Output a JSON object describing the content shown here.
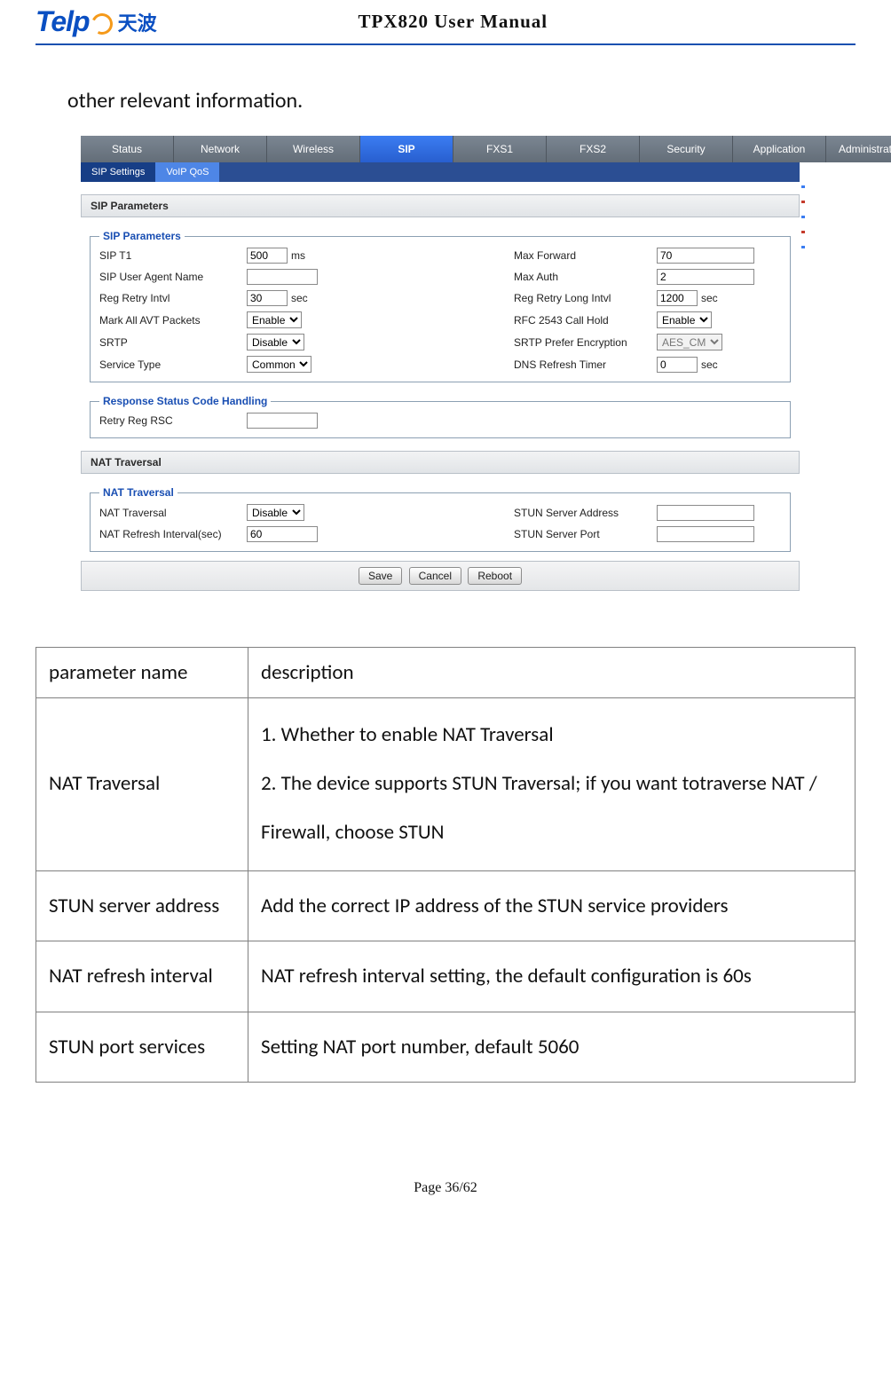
{
  "doc": {
    "brand_en": "Telp",
    "brand_cn": "天波",
    "title": "TPX820 User Manual",
    "intro": "other relevant information.",
    "page_label": "Page 36/62"
  },
  "tabs": {
    "items": [
      "Status",
      "Network",
      "Wireless",
      "SIP",
      "FXS1",
      "FXS2",
      "Security",
      "Application",
      "Administration"
    ],
    "active_index": 3,
    "sub_items": [
      "SIP Settings",
      "VoIP QoS"
    ],
    "sub_active_index": 1
  },
  "sections": {
    "sip_parameters_bar": "SIP Parameters",
    "sip_parameters_legend": "SIP Parameters",
    "rows": [
      {
        "l": "SIP T1",
        "ctrl": "text",
        "val": "500",
        "w": "w46",
        "unit": "ms",
        "r": "Max Forward",
        "rctrl": "text",
        "rval": "70",
        "rw": "w110",
        "runit": ""
      },
      {
        "l": "SIP User Agent Name",
        "ctrl": "text",
        "val": "",
        "w": "w80",
        "unit": "",
        "r": "Max Auth",
        "rctrl": "text",
        "rval": "2",
        "rw": "w110",
        "runit": ""
      },
      {
        "l": "Reg Retry Intvl",
        "ctrl": "text",
        "val": "30",
        "w": "w46",
        "unit": "sec",
        "r": "Reg Retry Long Intvl",
        "rctrl": "text",
        "rval": "1200",
        "rw": "w46",
        "runit": "sec"
      },
      {
        "l": "Mark All AVT Packets",
        "ctrl": "select",
        "val": "Enable",
        "unit": "",
        "r": "RFC 2543 Call Hold",
        "rctrl": "select",
        "rval": "Enable",
        "runit": ""
      },
      {
        "l": "SRTP",
        "ctrl": "select",
        "val": "Disable",
        "unit": "",
        "r": "SRTP Prefer Encryption",
        "rctrl": "select_disabled",
        "rval": "AES_CM",
        "runit": ""
      },
      {
        "l": "Service Type",
        "ctrl": "select",
        "val": "Common",
        "unit": "",
        "r": "DNS Refresh Timer",
        "rctrl": "text",
        "rval": "0",
        "rw": "w46",
        "runit": "sec"
      }
    ],
    "rsc_legend": "Response Status Code Handling",
    "rsc_label": "Retry Reg RSC",
    "rsc_val": "",
    "nat_bar": "NAT Traversal",
    "nat_legend": "NAT Traversal",
    "nat_rows": [
      {
        "l": "NAT Traversal",
        "ctrl": "select",
        "val": "Disable",
        "r": "STUN Server Address",
        "rctrl": "text",
        "rval": "",
        "rw": "w110"
      },
      {
        "l": "NAT Refresh Interval(sec)",
        "ctrl": "text",
        "val": "60",
        "w": "w80",
        "r": "STUN Server Port",
        "rctrl": "text",
        "rval": "",
        "rw": "w110"
      }
    ],
    "buttons": {
      "save": "Save",
      "cancel": "Cancel",
      "reboot": "Reboot"
    }
  },
  "table": {
    "header": {
      "param": "parameter name",
      "desc": "description"
    },
    "rows": [
      {
        "param": "NAT Traversal",
        "desc": "1. Whether to enable NAT Traversal\n2. The device supports STUN Traversal; if you want totraverse NAT / Firewall, choose STUN"
      },
      {
        "param": "STUN server address",
        "desc": "Add   the   correct IP address   of   the STUN service providers"
      },
      {
        "param": "NAT refresh interval",
        "desc": "NAT refresh     interval     setting,     the     default configuration is 60s"
      },
      {
        "param": "STUN port services",
        "desc": "Setting NAT port number, default 5060"
      }
    ]
  }
}
